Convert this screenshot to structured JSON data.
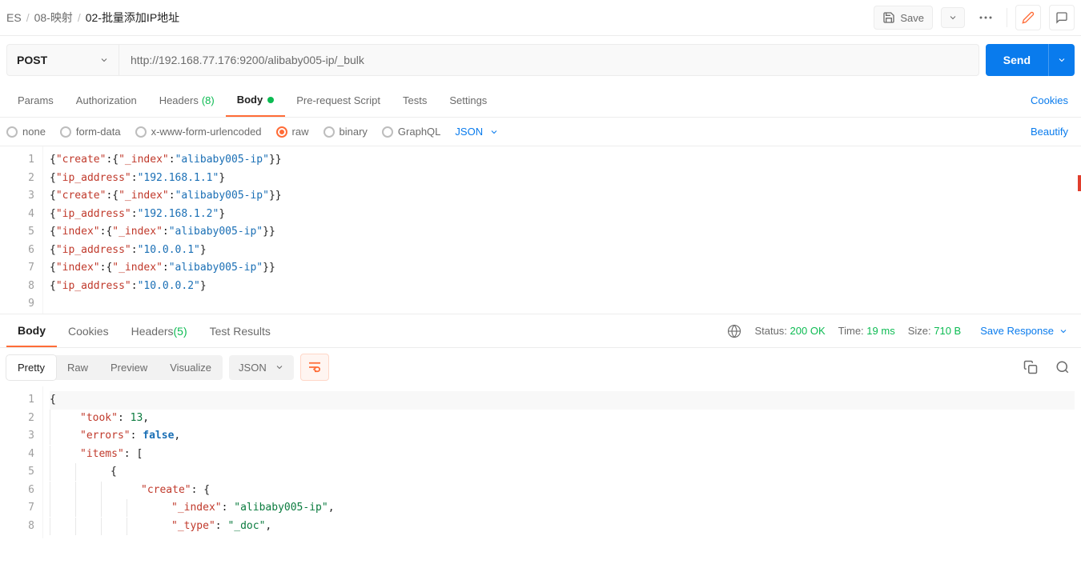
{
  "breadcrumb": {
    "a": "ES",
    "b": "08-映射",
    "c": "02-批量添加IP地址"
  },
  "topbar": {
    "save": "Save"
  },
  "request": {
    "method": "POST",
    "url": "http://192.168.77.176:9200/alibaby005-ip/_bulk",
    "send": "Send"
  },
  "tabs": {
    "params": "Params",
    "auth": "Authorization",
    "headers": "Headers",
    "headers_count": "(8)",
    "body": "Body",
    "prescript": "Pre-request Script",
    "tests": "Tests",
    "settings": "Settings",
    "cookies": "Cookies"
  },
  "bodytype": {
    "none": "none",
    "formdata": "form-data",
    "urlenc": "x-www-form-urlencoded",
    "raw": "raw",
    "binary": "binary",
    "graphql": "GraphQL",
    "json": "JSON",
    "beautify": "Beautify"
  },
  "req_lines": [
    {
      "pre": "{",
      "segs": [
        {
          "t": "k",
          "v": "\"create\""
        },
        {
          "t": "p",
          "v": ":{"
        },
        {
          "t": "k",
          "v": "\"_index\""
        },
        {
          "t": "p",
          "v": ":"
        },
        {
          "t": "f",
          "v": "\"alibaby005-ip\""
        },
        {
          "t": "p",
          "v": "}}"
        }
      ]
    },
    {
      "pre": "{",
      "segs": [
        {
          "t": "k",
          "v": "\"ip_address\""
        },
        {
          "t": "p",
          "v": ":"
        },
        {
          "t": "f",
          "v": "\"192.168.1.1\""
        },
        {
          "t": "p",
          "v": "}"
        }
      ]
    },
    {
      "pre": "{",
      "segs": [
        {
          "t": "k",
          "v": "\"create\""
        },
        {
          "t": "p",
          "v": ":{"
        },
        {
          "t": "k",
          "v": "\"_index\""
        },
        {
          "t": "p",
          "v": ":"
        },
        {
          "t": "f",
          "v": "\"alibaby005-ip\""
        },
        {
          "t": "p",
          "v": "}}"
        }
      ]
    },
    {
      "pre": "{",
      "segs": [
        {
          "t": "k",
          "v": "\"ip_address\""
        },
        {
          "t": "p",
          "v": ":"
        },
        {
          "t": "f",
          "v": "\"192.168.1.2\""
        },
        {
          "t": "p",
          "v": "}"
        }
      ]
    },
    {
      "pre": "{",
      "segs": [
        {
          "t": "k",
          "v": "\"index\""
        },
        {
          "t": "p",
          "v": ":{"
        },
        {
          "t": "k",
          "v": "\"_index\""
        },
        {
          "t": "p",
          "v": ":"
        },
        {
          "t": "f",
          "v": "\"alibaby005-ip\""
        },
        {
          "t": "p",
          "v": "}}"
        }
      ]
    },
    {
      "pre": "{",
      "segs": [
        {
          "t": "k",
          "v": "\"ip_address\""
        },
        {
          "t": "p",
          "v": ":"
        },
        {
          "t": "f",
          "v": "\"10.0.0.1\""
        },
        {
          "t": "p",
          "v": "}"
        }
      ]
    },
    {
      "pre": "{",
      "segs": [
        {
          "t": "k",
          "v": "\"index\""
        },
        {
          "t": "p",
          "v": ":{"
        },
        {
          "t": "k",
          "v": "\"_index\""
        },
        {
          "t": "p",
          "v": ":"
        },
        {
          "t": "f",
          "v": "\"alibaby005-ip\""
        },
        {
          "t": "p",
          "v": "}}"
        }
      ]
    },
    {
      "pre": "{",
      "segs": [
        {
          "t": "k",
          "v": "\"ip_address\""
        },
        {
          "t": "p",
          "v": ":"
        },
        {
          "t": "f",
          "v": "\"10.0.0.2\""
        },
        {
          "t": "p",
          "v": "}"
        }
      ]
    },
    {
      "pre": "",
      "segs": []
    }
  ],
  "resp_tabs": {
    "body": "Body",
    "cookies": "Cookies",
    "headers": "Headers",
    "headers_count": "(5)",
    "testresults": "Test Results"
  },
  "meta": {
    "status_l": "Status:",
    "status_v": "200 OK",
    "time_l": "Time:",
    "time_v": "19 ms",
    "size_l": "Size:",
    "size_v": "710 B",
    "save_resp": "Save Response"
  },
  "viewbar": {
    "pretty": "Pretty",
    "raw": "Raw",
    "preview": "Preview",
    "visualize": "Visualize",
    "json": "JSON"
  },
  "resp_lines": [
    {
      "indent": 0,
      "segs": [
        {
          "t": "p",
          "v": "{"
        }
      ],
      "hl": true
    },
    {
      "indent": 1,
      "segs": [
        {
          "t": "k",
          "v": "\"took\""
        },
        {
          "t": "p",
          "v": ": "
        },
        {
          "t": "n",
          "v": "13"
        },
        {
          "t": "p",
          "v": ","
        }
      ]
    },
    {
      "indent": 1,
      "segs": [
        {
          "t": "k",
          "v": "\"errors\""
        },
        {
          "t": "p",
          "v": ": "
        },
        {
          "t": "b",
          "v": "false"
        },
        {
          "t": "p",
          "v": ","
        }
      ]
    },
    {
      "indent": 1,
      "segs": [
        {
          "t": "k",
          "v": "\"items\""
        },
        {
          "t": "p",
          "v": ": ["
        }
      ]
    },
    {
      "indent": 2,
      "segs": [
        {
          "t": "p",
          "v": "{"
        }
      ]
    },
    {
      "indent": 3,
      "segs": [
        {
          "t": "k",
          "v": "\"create\""
        },
        {
          "t": "p",
          "v": ": {"
        }
      ]
    },
    {
      "indent": 4,
      "segs": [
        {
          "t": "k",
          "v": "\"_index\""
        },
        {
          "t": "p",
          "v": ": "
        },
        {
          "t": "s",
          "v": "\"alibaby005-ip\""
        },
        {
          "t": "p",
          "v": ","
        }
      ]
    },
    {
      "indent": 4,
      "segs": [
        {
          "t": "k",
          "v": "\"_type\""
        },
        {
          "t": "p",
          "v": ": "
        },
        {
          "t": "s",
          "v": "\"_doc\""
        },
        {
          "t": "p",
          "v": ","
        }
      ]
    }
  ]
}
